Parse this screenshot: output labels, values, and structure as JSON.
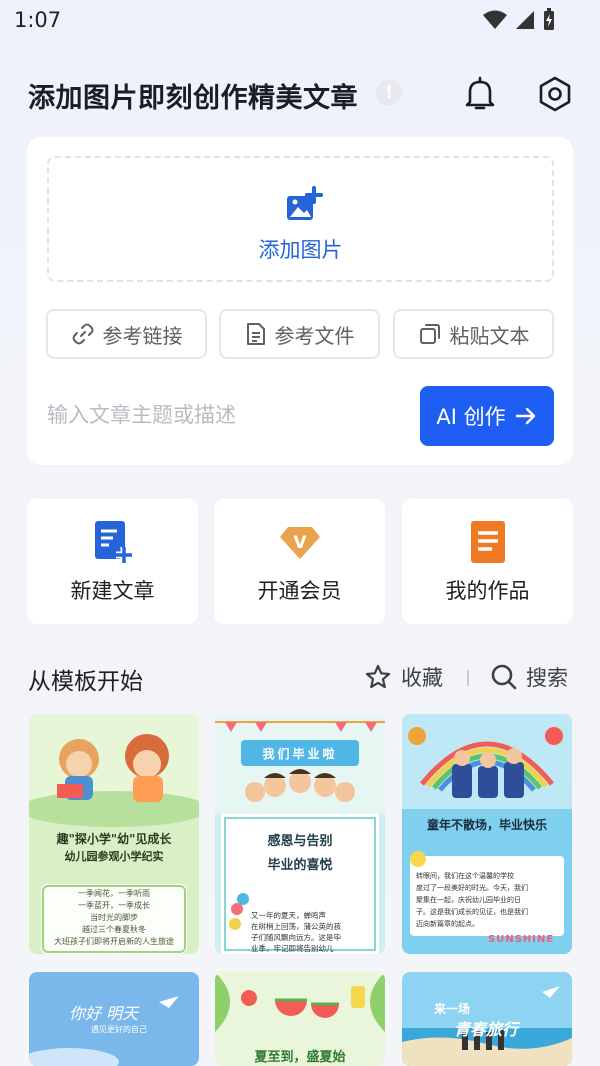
{
  "status_bar": {
    "time": "1:07"
  },
  "header": {
    "title": "添加图片即刻创作精美文章",
    "info_mark": "!"
  },
  "compose": {
    "add_image_label": "添加图片",
    "ref_link_label": "参考链接",
    "ref_file_label": "参考文件",
    "paste_text_label": "粘贴文本",
    "topic_placeholder": "输入文章主题或描述",
    "ai_button_label": "AI 创作"
  },
  "quick_actions": {
    "new_article": "新建文章",
    "membership": "开通会员",
    "my_works": "我的作品",
    "vip_mark": "V"
  },
  "templates": {
    "section_title": "从模板开始",
    "favorites_label": "收藏",
    "search_label": "搜索",
    "cards": [
      {
        "title": "趣\"探小学\"幼\"见成长",
        "subtitle": "幼儿园参观小学纪实",
        "body": [
          "一季闻花，一季听雨",
          "一季蓝开，一季成长",
          "当时光的脚步",
          "越过三个春夏秋冬",
          "大班孩子们即将开启新的人生旅途"
        ]
      },
      {
        "banner": "我们毕业啦",
        "title": "感恩与告别",
        "subtitle": "毕业的喜悦",
        "body": [
          "又一年的夏天，蝉鸣声",
          "在树梢上回荡，蒲公英的孩",
          "子们随风飘向远方。这是毕",
          "业季，牢记即将告别幼儿"
        ]
      },
      {
        "title": "童年不散场，毕业快乐",
        "body": [
          "转眼间，我们在这个温馨的学校",
          "度过了一段美好的时光。今天，我们",
          "聚集在一起，庆祝幼儿园毕业的日",
          "子。这是我们成长的见证，也是我们",
          "迈向新篇章的起点。"
        ],
        "tag": "SUNSHINE"
      },
      {
        "title": "你好 明天",
        "subtitle": "遇见更好的自己"
      },
      {
        "title": "夏至到，盛夏始"
      },
      {
        "title": "来一场",
        "subtitle": "青春旅行"
      }
    ]
  },
  "colors": {
    "accent": "#1f5ef2",
    "link_blue": "#2563d8",
    "vip_gold": "#e9a34a",
    "works_orange": "#f07a23"
  }
}
